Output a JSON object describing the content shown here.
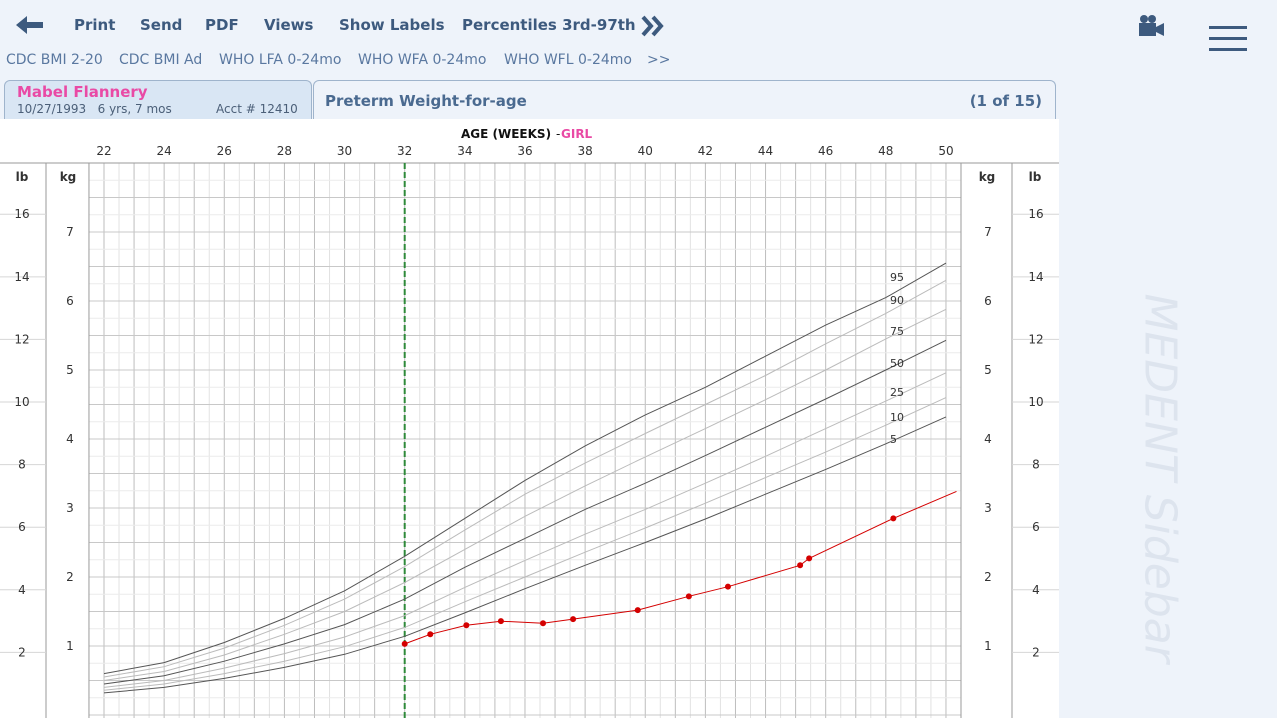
{
  "toolbar": {
    "print": "Print",
    "send": "Send",
    "pdf": "PDF",
    "views": "Views",
    "show_labels": "Show Labels",
    "percentiles": "Percentiles 3rd-97th",
    "icons": [
      "back-arrow-icon",
      "double-chevron-right-icon",
      "video-camera-icon",
      "hamburger-menu-icon"
    ]
  },
  "chart_tabs": [
    "CDC BMI 2-20",
    "CDC BMI Ad",
    "WHO LFA 0-24mo",
    "WHO WFA 0-24mo",
    "WHO WFL 0-24mo",
    ">>"
  ],
  "patient": {
    "name": "Mabel Flannery",
    "dob": "10/27/1993",
    "age": "6 yrs, 7 mos",
    "acct": "Acct # 12410"
  },
  "chart_header": {
    "title": "Preterm Weight-for-age",
    "count": "(1 of 15)"
  },
  "sidebar": {
    "label": "MEDENT Sidebar"
  },
  "colors": {
    "accent": "#3d5a7e",
    "patient_name": "#e94aa5",
    "patient_series": "#d40000",
    "marker_line": "#2f8a3a",
    "percentile_dark": "#555555",
    "percentile_light": "#bbbbbb"
  },
  "chart_data": {
    "type": "line",
    "title": "AGE (WEEKS)",
    "title_sex": "GIRL",
    "xlabel": "AGE (WEEKS)",
    "ylabel": "kg",
    "ylabel_secondary": "lb",
    "xlim": [
      21.5,
      50.5
    ],
    "ylim": [
      0,
      7.75
    ],
    "xticks": [
      22,
      24,
      26,
      28,
      30,
      32,
      34,
      36,
      38,
      40,
      42,
      44,
      46,
      48,
      50
    ],
    "yticks_kg": [
      1,
      2,
      3,
      4,
      5,
      6,
      7
    ],
    "yticks_lb": [
      2,
      4,
      6,
      8,
      10,
      12,
      14,
      16
    ],
    "grid": true,
    "current_age_marker": 32,
    "percentile_labels": [
      "95",
      "90",
      "75",
      "50",
      "25",
      "10",
      "5"
    ],
    "series": [
      {
        "name": "95",
        "style": "dark",
        "x": [
          22,
          24,
          26,
          28,
          30,
          32,
          34,
          36,
          38,
          40,
          42,
          44,
          46,
          48,
          50
        ],
        "y": [
          0.6,
          0.76,
          1.05,
          1.4,
          1.8,
          2.3,
          2.85,
          3.4,
          3.9,
          4.35,
          4.75,
          5.2,
          5.65,
          6.05,
          6.55
        ]
      },
      {
        "name": "90",
        "style": "light",
        "x": [
          22,
          24,
          26,
          28,
          30,
          32,
          34,
          36,
          38,
          40,
          42,
          44,
          46,
          48,
          50
        ],
        "y": [
          0.55,
          0.7,
          0.97,
          1.3,
          1.68,
          2.15,
          2.68,
          3.2,
          3.65,
          4.08,
          4.5,
          4.92,
          5.38,
          5.82,
          6.3
        ]
      },
      {
        "name": "75",
        "style": "light",
        "x": [
          22,
          24,
          26,
          28,
          30,
          32,
          34,
          36,
          38,
          40,
          42,
          44,
          46,
          48,
          50
        ],
        "y": [
          0.5,
          0.63,
          0.87,
          1.17,
          1.5,
          1.92,
          2.4,
          2.88,
          3.32,
          3.74,
          4.15,
          4.57,
          5.0,
          5.45,
          5.88
        ]
      },
      {
        "name": "50",
        "style": "dark",
        "x": [
          22,
          24,
          26,
          28,
          30,
          32,
          34,
          36,
          38,
          40,
          42,
          44,
          46,
          48,
          50
        ],
        "y": [
          0.45,
          0.57,
          0.78,
          1.03,
          1.31,
          1.68,
          2.14,
          2.56,
          2.98,
          3.36,
          3.76,
          4.17,
          4.58,
          5.0,
          5.43
        ]
      },
      {
        "name": "25",
        "style": "light",
        "x": [
          22,
          24,
          26,
          28,
          30,
          32,
          34,
          36,
          38,
          40,
          42,
          44,
          46,
          48,
          50
        ],
        "y": [
          0.4,
          0.5,
          0.68,
          0.89,
          1.13,
          1.44,
          1.85,
          2.24,
          2.62,
          2.98,
          3.36,
          3.75,
          4.15,
          4.55,
          4.96
        ]
      },
      {
        "name": "10",
        "style": "light",
        "x": [
          22,
          24,
          26,
          28,
          30,
          32,
          34,
          36,
          38,
          40,
          42,
          44,
          46,
          48,
          50
        ],
        "y": [
          0.36,
          0.45,
          0.6,
          0.78,
          0.99,
          1.27,
          1.64,
          2.0,
          2.36,
          2.71,
          3.07,
          3.44,
          3.81,
          4.2,
          4.6
        ]
      },
      {
        "name": "5",
        "style": "dark",
        "x": [
          22,
          24,
          26,
          28,
          30,
          32,
          34,
          36,
          38,
          40,
          42,
          44,
          46,
          48,
          50
        ],
        "y": [
          0.32,
          0.4,
          0.53,
          0.69,
          0.88,
          1.14,
          1.48,
          1.83,
          2.17,
          2.5,
          2.84,
          3.2,
          3.56,
          3.93,
          4.32
        ]
      },
      {
        "name": "patient",
        "style": "patient",
        "x": [
          32,
          32.85,
          34.05,
          35.2,
          36.6,
          37.6,
          39.75,
          41.45,
          42.75,
          45.15,
          45.45,
          48.25,
          50.35
        ],
        "y": [
          1.03,
          1.17,
          1.3,
          1.36,
          1.33,
          1.39,
          1.52,
          1.72,
          1.86,
          2.17,
          2.27,
          2.85,
          3.24
        ]
      }
    ]
  }
}
